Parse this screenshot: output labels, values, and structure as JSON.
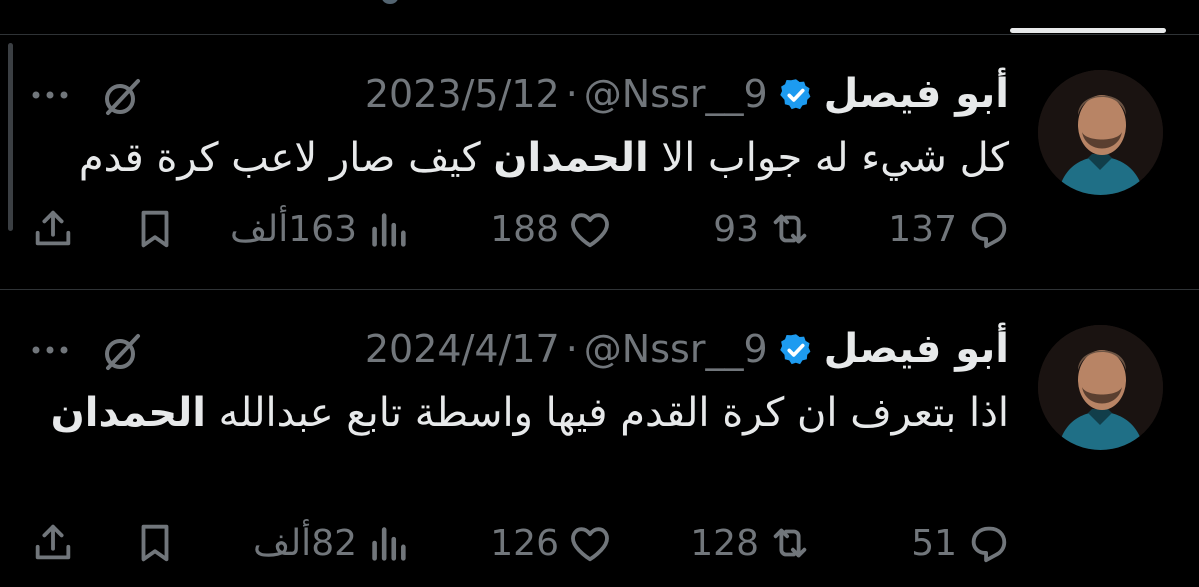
{
  "tabs": {
    "active_indicator": true
  },
  "tweets": [
    {
      "display_name": "أبو فيصل",
      "handle": "@Nssr__9",
      "separator": "·",
      "date": "2023/5/12",
      "text_part1": "كل شيء له جواب الا ",
      "text_strong": "الحمدان",
      "text_part2": " كيف صار لاعب كرة قدم",
      "reply_count": "137",
      "retweet_count": "93",
      "like_count": "188",
      "views_count": "163ألف"
    },
    {
      "display_name": "أبو فيصل",
      "handle": "@Nssr__9",
      "separator": "·",
      "date": "2024/4/17",
      "text_part1": "اذا بتعرف ان كرة القدم فيها واسطة تابع عبدالله ",
      "text_strong": "الحمدان",
      "text_part2": "",
      "reply_count": "51",
      "retweet_count": "128",
      "like_count": "126",
      "views_count": "82ألف"
    }
  ],
  "icons": {
    "verified": "verified-badge-icon",
    "grok": "grok-icon",
    "more": "more-icon",
    "reply": "reply-icon",
    "retweet": "retweet-icon",
    "like": "like-icon",
    "views": "views-icon",
    "bookmark": "bookmark-icon",
    "share": "share-icon"
  },
  "colors": {
    "background": "#000000",
    "text": "#e7e9ea",
    "muted": "#71767b",
    "verified": "#1d9bf0",
    "divider": "#2f3336"
  }
}
